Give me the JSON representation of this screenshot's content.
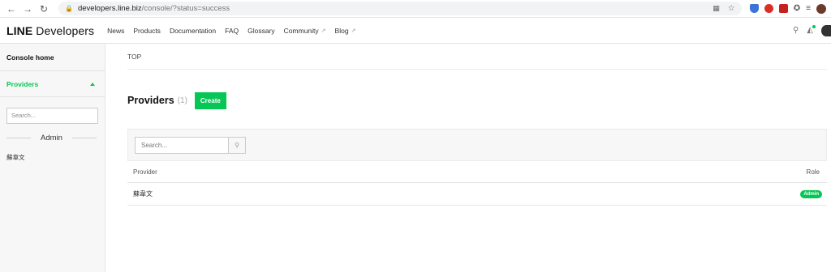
{
  "browser": {
    "url_host": "developers.line.biz",
    "url_path": "/console/?status=success",
    "colors": {
      "ext_blue": "#3b73d8",
      "ext_red": "#d93025",
      "ext_pdf": "#c5221f"
    }
  },
  "header": {
    "logo_bold": "LINE",
    "logo_rest": "Developers",
    "nav": [
      {
        "label": "News"
      },
      {
        "label": "Products"
      },
      {
        "label": "Documentation"
      },
      {
        "label": "FAQ"
      },
      {
        "label": "Glossary"
      },
      {
        "label": "Community",
        "external": true
      },
      {
        "label": "Blog",
        "external": true
      }
    ]
  },
  "sidebar": {
    "home_label": "Console home",
    "providers_label": "Providers",
    "search_placeholder": "Search...",
    "role_divider": "Admin",
    "provider_item": "蘇韋文"
  },
  "main": {
    "breadcrumb": "TOP",
    "title": "Providers",
    "count": "(1)",
    "create_label": "Create",
    "search_placeholder": "Search...",
    "table": {
      "col_provider": "Provider",
      "col_role": "Role",
      "rows": [
        {
          "provider": "蘇韋文",
          "role": "Admin"
        }
      ]
    }
  },
  "theme": {
    "accent": "#06c755"
  }
}
